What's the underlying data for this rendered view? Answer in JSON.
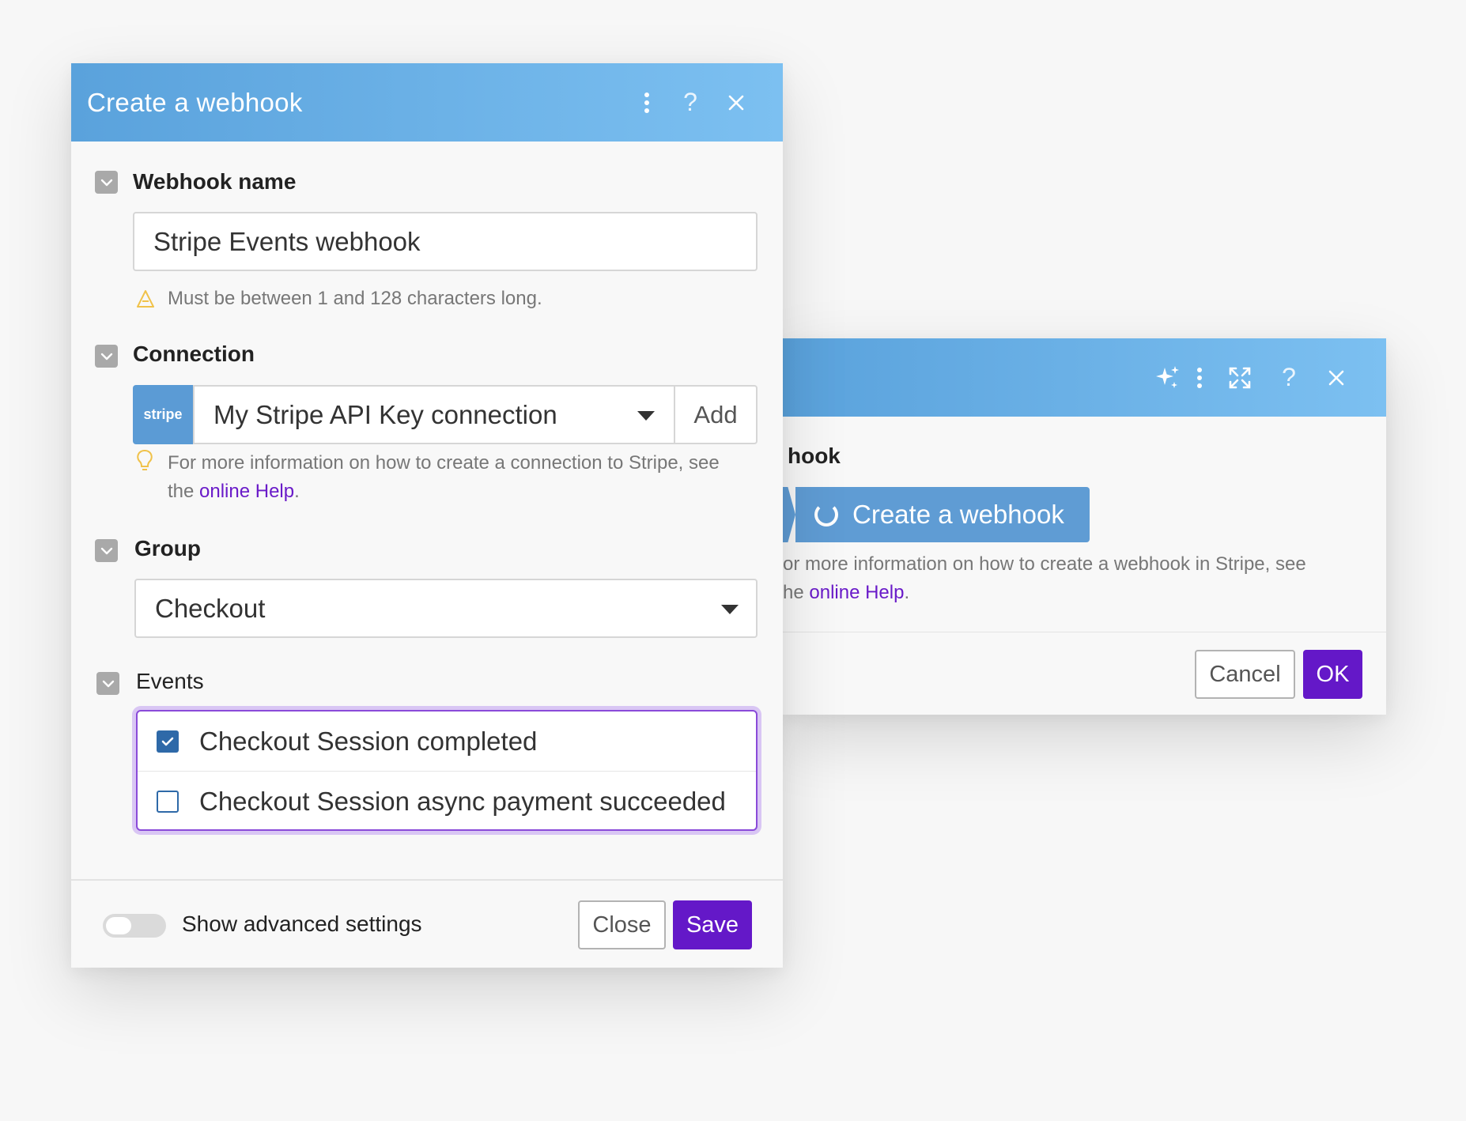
{
  "back_dialog": {
    "section_label": "hook",
    "create_button_label": "Create a webhook",
    "help_line1": "or more information on how to create a webhook in Stripe, see",
    "help_line2_prefix": "he ",
    "help_link": "online Help",
    "help_suffix": ".",
    "cancel_label": "Cancel",
    "ok_label": "OK"
  },
  "front_dialog": {
    "title": "Create a webhook",
    "webhook_name": {
      "label": "Webhook name",
      "value": "Stripe Events webhook",
      "hint": "Must be between 1 and 128 characters long."
    },
    "connection": {
      "label": "Connection",
      "badge": "stripe",
      "value": "My Stripe API Key connection",
      "add_label": "Add",
      "hint_line1": "For more information on how to create a connection to Stripe, see",
      "hint_line2_prefix": "the ",
      "hint_link": "online Help",
      "hint_suffix": "."
    },
    "group": {
      "label": "Group",
      "value": "Checkout"
    },
    "events": {
      "label": "Events",
      "items": [
        {
          "label": "Checkout Session completed",
          "checked": true
        },
        {
          "label": "Checkout Session async payment succeeded",
          "checked": false
        }
      ]
    },
    "footer": {
      "advanced_label": "Show advanced settings",
      "close_label": "Close",
      "save_label": "Save"
    }
  },
  "colors": {
    "header_gradient_start": "#5aa2dc",
    "header_gradient_end": "#7cc0f1",
    "primary": "#6418c8",
    "link": "#6a1bc9",
    "checkbox": "#2e69a8",
    "warning": "#f0c24a"
  },
  "icons": [
    "more-vertical-icon",
    "help-icon",
    "close-icon",
    "sparkles-icon",
    "expand-icon",
    "chevron-down-icon",
    "warning-icon",
    "lightbulb-icon",
    "spinner-icon",
    "check-icon"
  ]
}
